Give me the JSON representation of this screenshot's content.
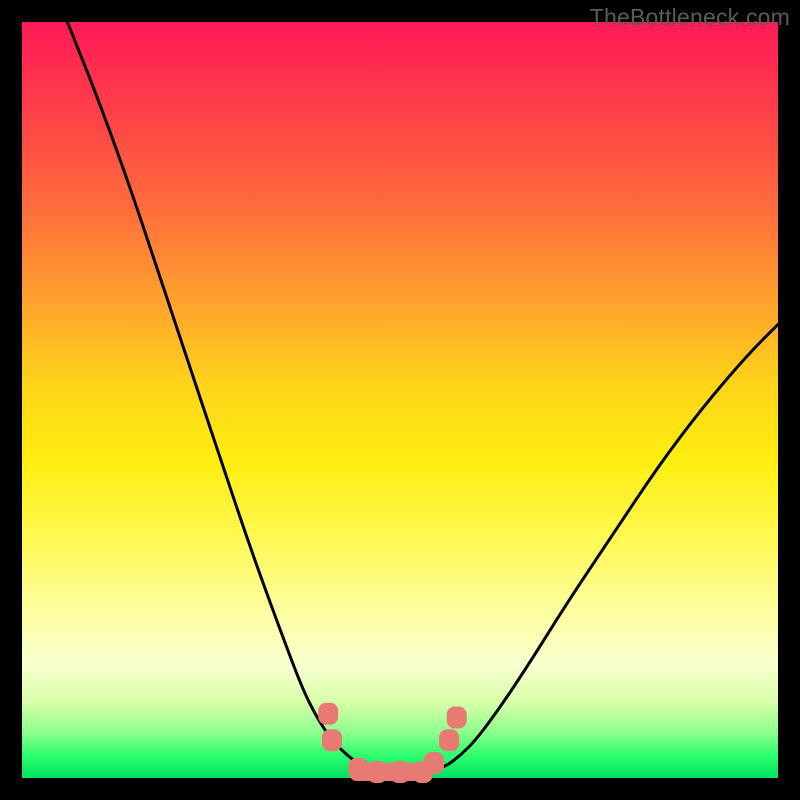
{
  "watermark": "TheBottleneck.com",
  "chart_data": {
    "type": "line",
    "title": "",
    "xlabel": "",
    "ylabel": "",
    "xlim": [
      0,
      100
    ],
    "ylim": [
      0,
      100
    ],
    "grid": false,
    "legend": false,
    "annotations": [],
    "series": [
      {
        "name": "curve-left",
        "stroke": "#000000",
        "x": [
          6,
          10,
          14,
          18,
          22,
          26,
          30,
          34,
          37,
          39,
          41,
          43,
          45,
          46
        ],
        "y": [
          100,
          90,
          79,
          67,
          55,
          43,
          31,
          20,
          12,
          8,
          5,
          3,
          1.5,
          1
        ]
      },
      {
        "name": "curve-right",
        "stroke": "#000000",
        "x": [
          54,
          56,
          58,
          60,
          63,
          67,
          72,
          78,
          84,
          90,
          96,
          100
        ],
        "y": [
          1,
          1.5,
          3,
          5,
          9,
          15,
          23,
          32,
          41,
          49,
          56,
          60
        ]
      },
      {
        "name": "markers-scatter",
        "stroke": "#e87a74",
        "type_hint": "scatter",
        "x": [
          40.5,
          41.0,
          44.5,
          47.0,
          50.0,
          53.0,
          54.5,
          56.5,
          57.5
        ],
        "y": [
          8.5,
          5.0,
          1.2,
          0.8,
          0.8,
          0.8,
          2.0,
          5.0,
          8.0
        ]
      }
    ]
  }
}
